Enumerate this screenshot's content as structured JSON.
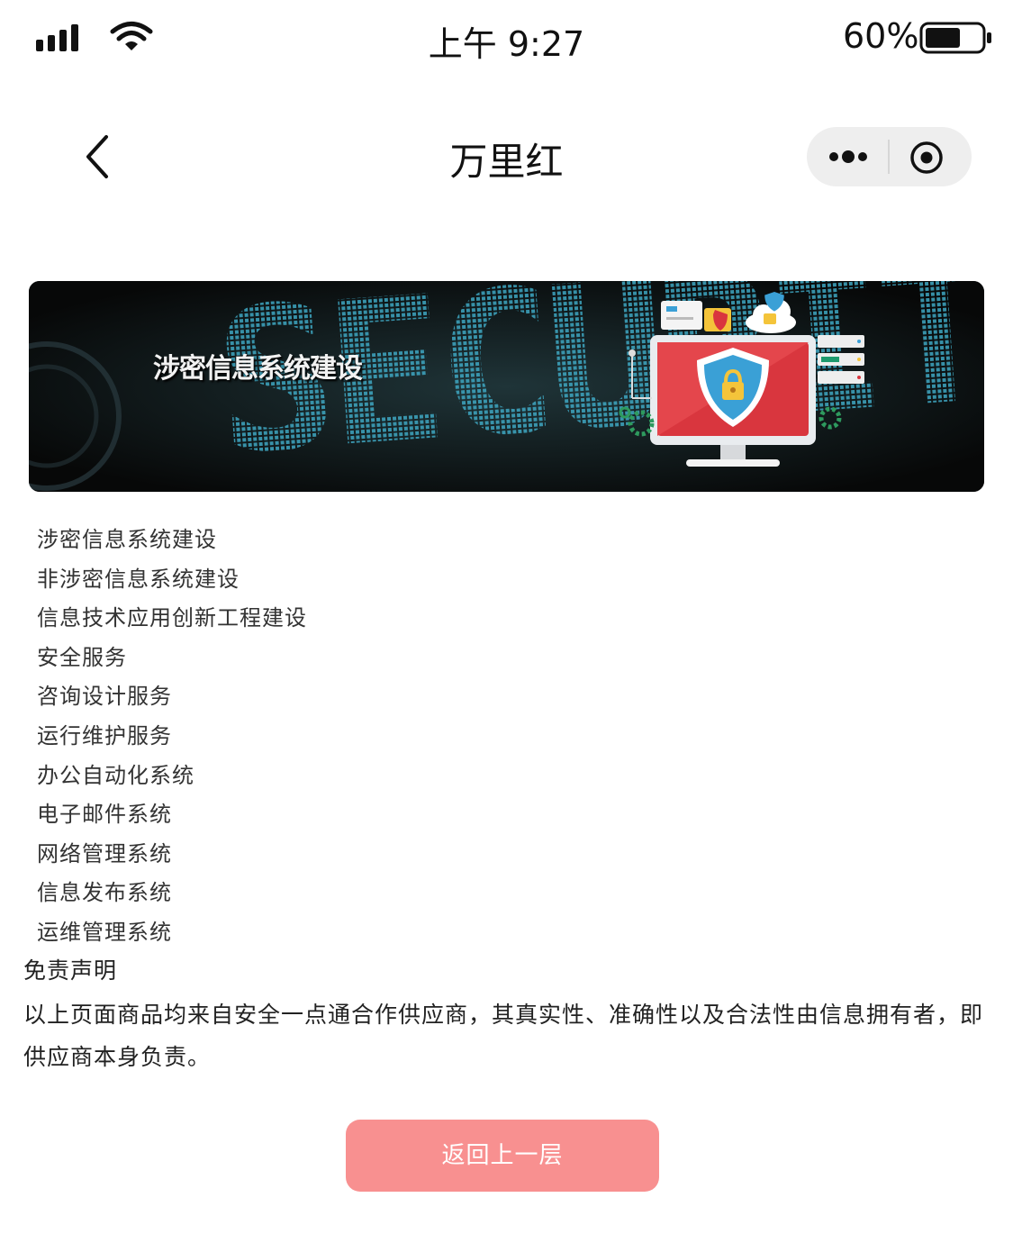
{
  "status_bar": {
    "time": "上午 9:27",
    "battery_percent": "60%",
    "battery_level": 0.6,
    "icons": [
      "signal-icon",
      "wifi-icon",
      "battery-icon"
    ]
  },
  "nav": {
    "title": "万里红",
    "icons": [
      "back-chevron-icon",
      "more-dots-icon",
      "close-target-icon"
    ]
  },
  "banner": {
    "title": "涉密信息系统建设",
    "background_word": "SECURITY",
    "icons": [
      "monitor-shield-lock-icon",
      "cloud-lock-icon",
      "server-icon",
      "gear-icon"
    ]
  },
  "services": [
    "涉密信息系统建设",
    "非涉密信息系统建设",
    "信息技术应用创新工程建设",
    "安全服务",
    "咨询设计服务",
    "运行维护服务",
    "办公自动化系统",
    "电子邮件系统",
    "网络管理系统",
    "信息发布系统",
    "运维管理系统"
  ],
  "disclaimer": {
    "title": "免责声明",
    "text": "以上页面商品均来自安全一点通合作供应商，其真实性、准确性以及合法性由信息拥有者，即供应商本身负责。"
  },
  "back_button": {
    "label": "返回上一层"
  },
  "colors": {
    "button_bg": "#f89090",
    "capsule_bg": "#eeeeee",
    "banner_bg": "#0c1011"
  }
}
